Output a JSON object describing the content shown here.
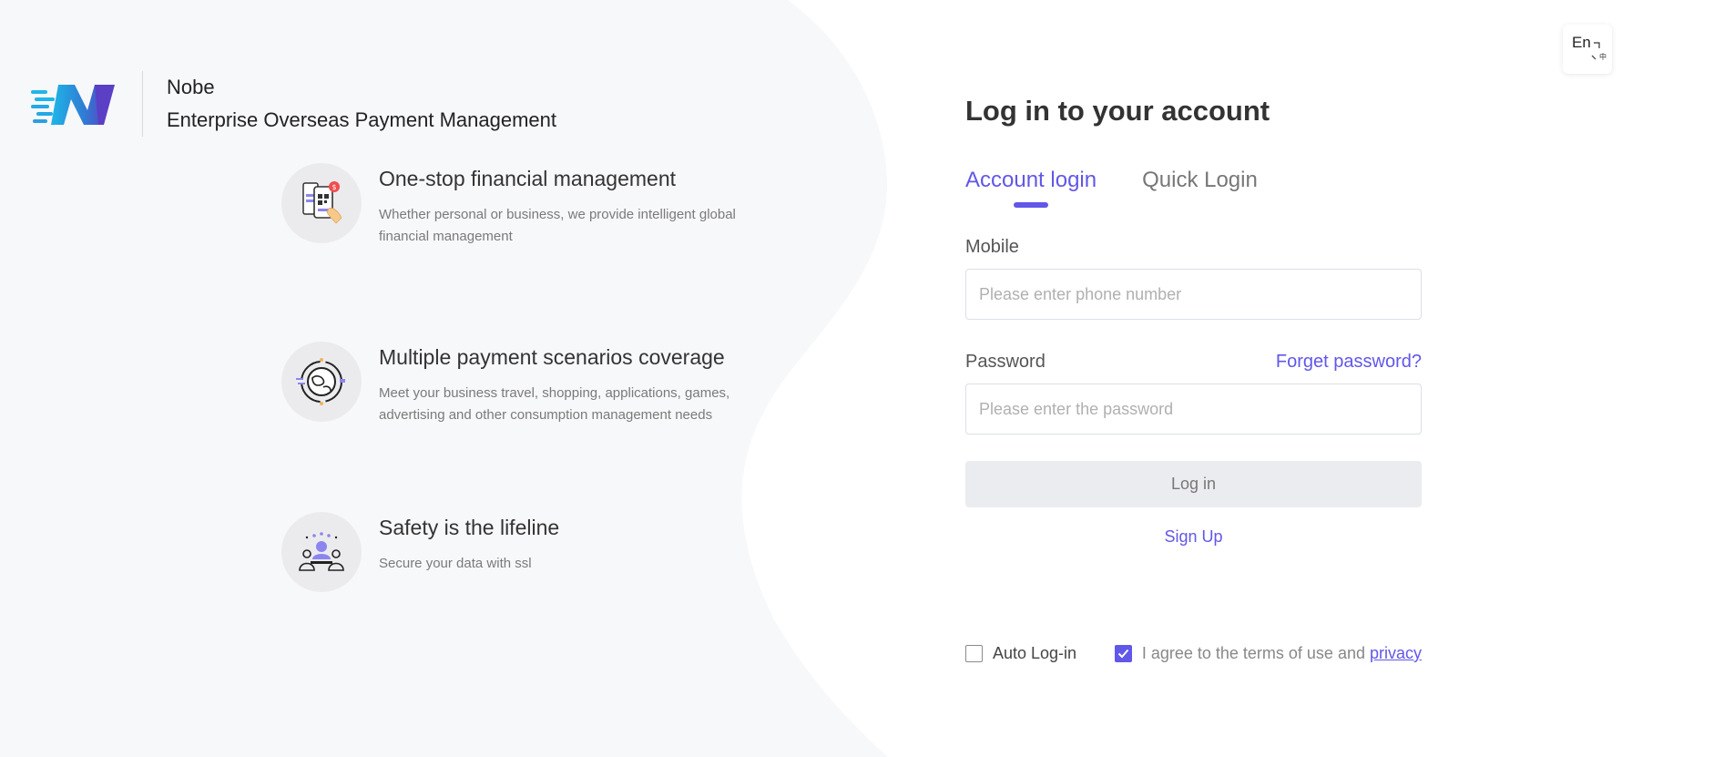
{
  "brand": {
    "name": "Nobe",
    "tagline": "Enterprise Overseas Payment Management",
    "accent_color": "#6157e8"
  },
  "features": [
    {
      "icon": "phone-qr-payment-icon",
      "title": "One-stop financial management",
      "description": "Whether personal or business, we provide intelligent global financial management"
    },
    {
      "icon": "globe-icon",
      "title": "Multiple payment scenarios coverage",
      "description": "Meet your business travel, shopping, applications, games, advertising and other consumption management needs"
    },
    {
      "icon": "security-team-icon",
      "title": "Safety is the lifeline",
      "description": "Secure your data with ssl"
    }
  ],
  "language": {
    "label": "En"
  },
  "login": {
    "title": "Log in to your account",
    "tabs": [
      {
        "label": "Account login",
        "active": true
      },
      {
        "label": "Quick Login",
        "active": false
      }
    ],
    "mobile_label": "Mobile",
    "mobile_placeholder": "Please enter phone number",
    "password_label": "Password",
    "forgot_password": "Forget password?",
    "password_placeholder": "Please enter the password",
    "login_button": "Log in",
    "signup_link": "Sign Up",
    "auto_login_label": "Auto Log-in",
    "auto_login_checked": false,
    "agree_text": "I agree to the terms of use and",
    "privacy_link": "privacy",
    "agree_checked": true
  }
}
